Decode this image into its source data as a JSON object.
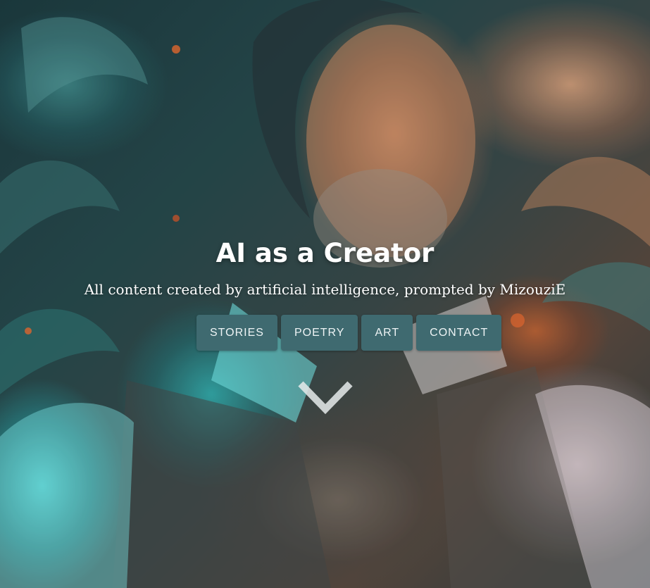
{
  "hero": {
    "title": "AI as a Creator",
    "subtitle": "All content created by artificial intelligence, prompted by MizouziE",
    "background_image": "ai-generated-portrait-man-with-beard-floral-background"
  },
  "nav": {
    "items": [
      {
        "label": "STORIES"
      },
      {
        "label": "POETRY"
      },
      {
        "label": "ART"
      },
      {
        "label": "CONTACT"
      }
    ]
  },
  "scroll_indicator": {
    "icon": "chevron-down-icon"
  },
  "colors": {
    "button_bg": "#3f6a70",
    "text": "#ffffff"
  }
}
